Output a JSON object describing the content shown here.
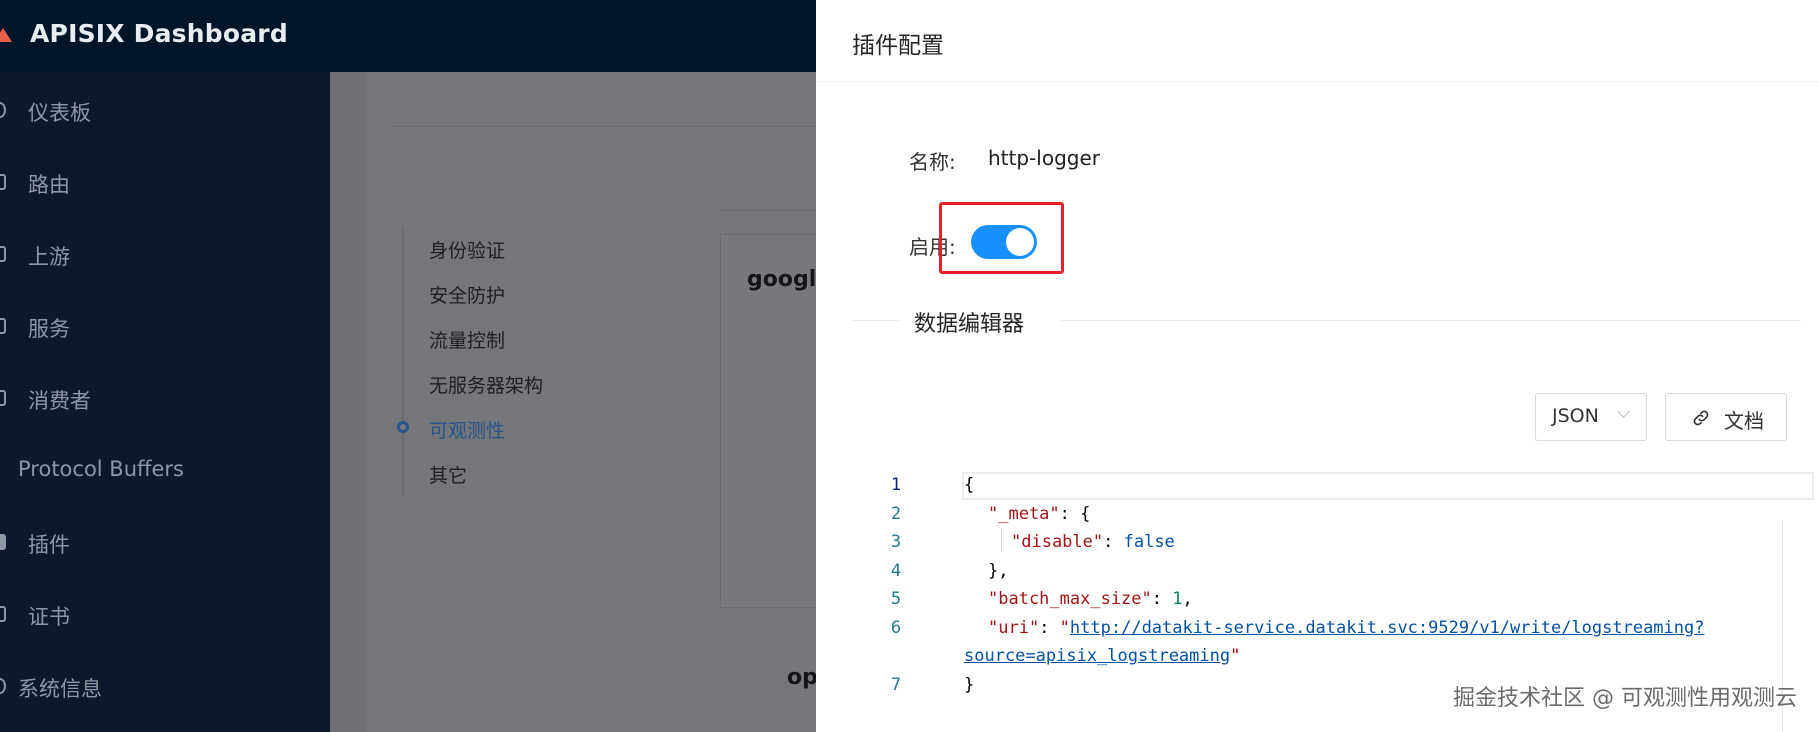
{
  "app": {
    "title": "APISIX Dashboard"
  },
  "sidebar": {
    "items": [
      {
        "label": "仪表板",
        "icon": "dashboard-icon"
      },
      {
        "label": "路由",
        "icon": "route-icon"
      },
      {
        "label": "上游",
        "icon": "upstream-icon"
      },
      {
        "label": "服务",
        "icon": "service-icon"
      },
      {
        "label": "消费者",
        "icon": "consumer-icon"
      },
      {
        "label": "Protocol Buffers",
        "icon": "proto-icon"
      },
      {
        "label": "插件",
        "icon": "plugin-icon"
      },
      {
        "label": "证书",
        "icon": "certificate-icon"
      },
      {
        "label": "系统信息",
        "icon": "info-icon"
      }
    ]
  },
  "background": {
    "categories": [
      "身份验证",
      "安全防护",
      "流量控制",
      "无服务器架构",
      "可观测性",
      "其它"
    ],
    "active_category": "可观测性",
    "card_titles": [
      "google",
      "op"
    ]
  },
  "drawer": {
    "title": "插件配置",
    "name_label": "名称:",
    "name_value": "http-logger",
    "enable_label": "启用:",
    "enabled": true,
    "section_title": "数据编辑器",
    "format_select": "JSON",
    "doc_button": "文档"
  },
  "editor": {
    "line_numbers": [
      "1",
      "2",
      "3",
      "4",
      "5",
      "6",
      "7"
    ],
    "tokens": {
      "open_brace": "{",
      "meta_key": "\"_meta\"",
      "colon_brace": ": {",
      "disable_key": "\"disable\"",
      "colon": ": ",
      "disable_value": "false",
      "close_meta": "},",
      "batch_key": "\"batch_max_size\"",
      "batch_value": "1",
      "comma": ",",
      "uri_key": "\"uri\"",
      "uri_quote_open": "\"",
      "uri_part1": "http://datakit-service.datakit.svc:9529/v1/write/logstreaming?",
      "uri_part2": "source=apisix_logstreaming",
      "uri_quote_close": "\"",
      "close_brace": "}"
    }
  },
  "watermark": "掘金技术社区 @ 可观测性用观测云",
  "colors": {
    "switch_on": "#1890ff",
    "highlight_border": "#e8202a",
    "nav_bg": "#001529"
  }
}
